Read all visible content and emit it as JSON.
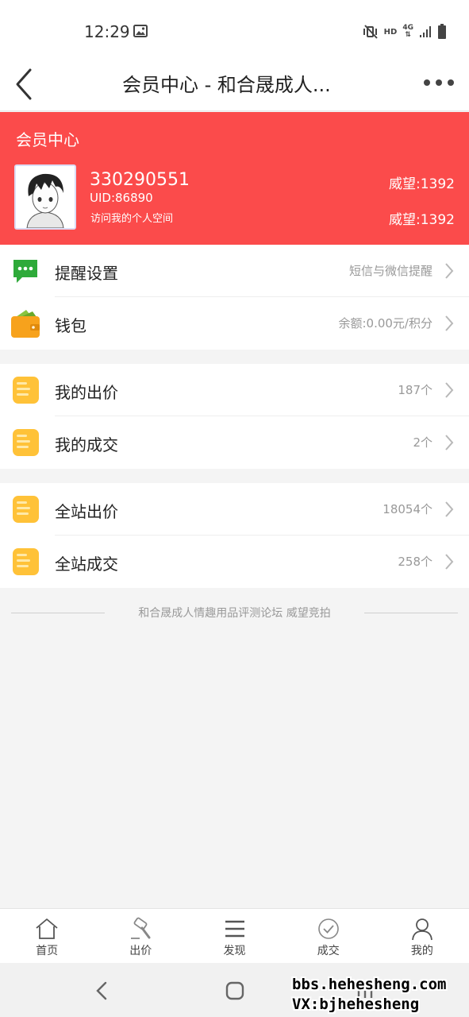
{
  "status_bar": {
    "time": "12:29",
    "network_hd": "HD",
    "network_4g": "4G"
  },
  "header": {
    "title": "会员中心 - 和合晟成人..."
  },
  "member_card": {
    "title": "会员中心",
    "username": "330290551",
    "uid": "UID:86890",
    "visit_link": "访问我的个人空间",
    "prestige_1": "威望:1392",
    "prestige_2": "威望:1392"
  },
  "settings": [
    {
      "label": "提醒设置",
      "value": "短信与微信提醒"
    },
    {
      "label": "钱包",
      "value": "余额:0.00元/积分"
    }
  ],
  "my_records": [
    {
      "label": "我的出价",
      "value": "187个"
    },
    {
      "label": "我的成交",
      "value": "2个"
    }
  ],
  "site_records": [
    {
      "label": "全站出价",
      "value": "18054个"
    },
    {
      "label": "全站成交",
      "value": "258个"
    }
  ],
  "footer_text": "和合晟成人情趣用品评测论坛 威望竞拍",
  "tabs": [
    {
      "label": "首页",
      "icon": "home-icon"
    },
    {
      "label": "出价",
      "icon": "auction-hammer-icon"
    },
    {
      "label": "发现",
      "icon": "menu-icon"
    },
    {
      "label": "成交",
      "icon": "check-circle-icon"
    },
    {
      "label": "我的",
      "icon": "user-icon"
    }
  ],
  "watermark": {
    "line1": "bbs.hehesheng.com",
    "line2": "VX:bjhehesheng"
  },
  "colors": {
    "brand_red": "#fb4b4b",
    "chat_green": "#2eaa3a",
    "doc_yellow": "#ffc238",
    "wallet_orange": "#f7a21c"
  }
}
